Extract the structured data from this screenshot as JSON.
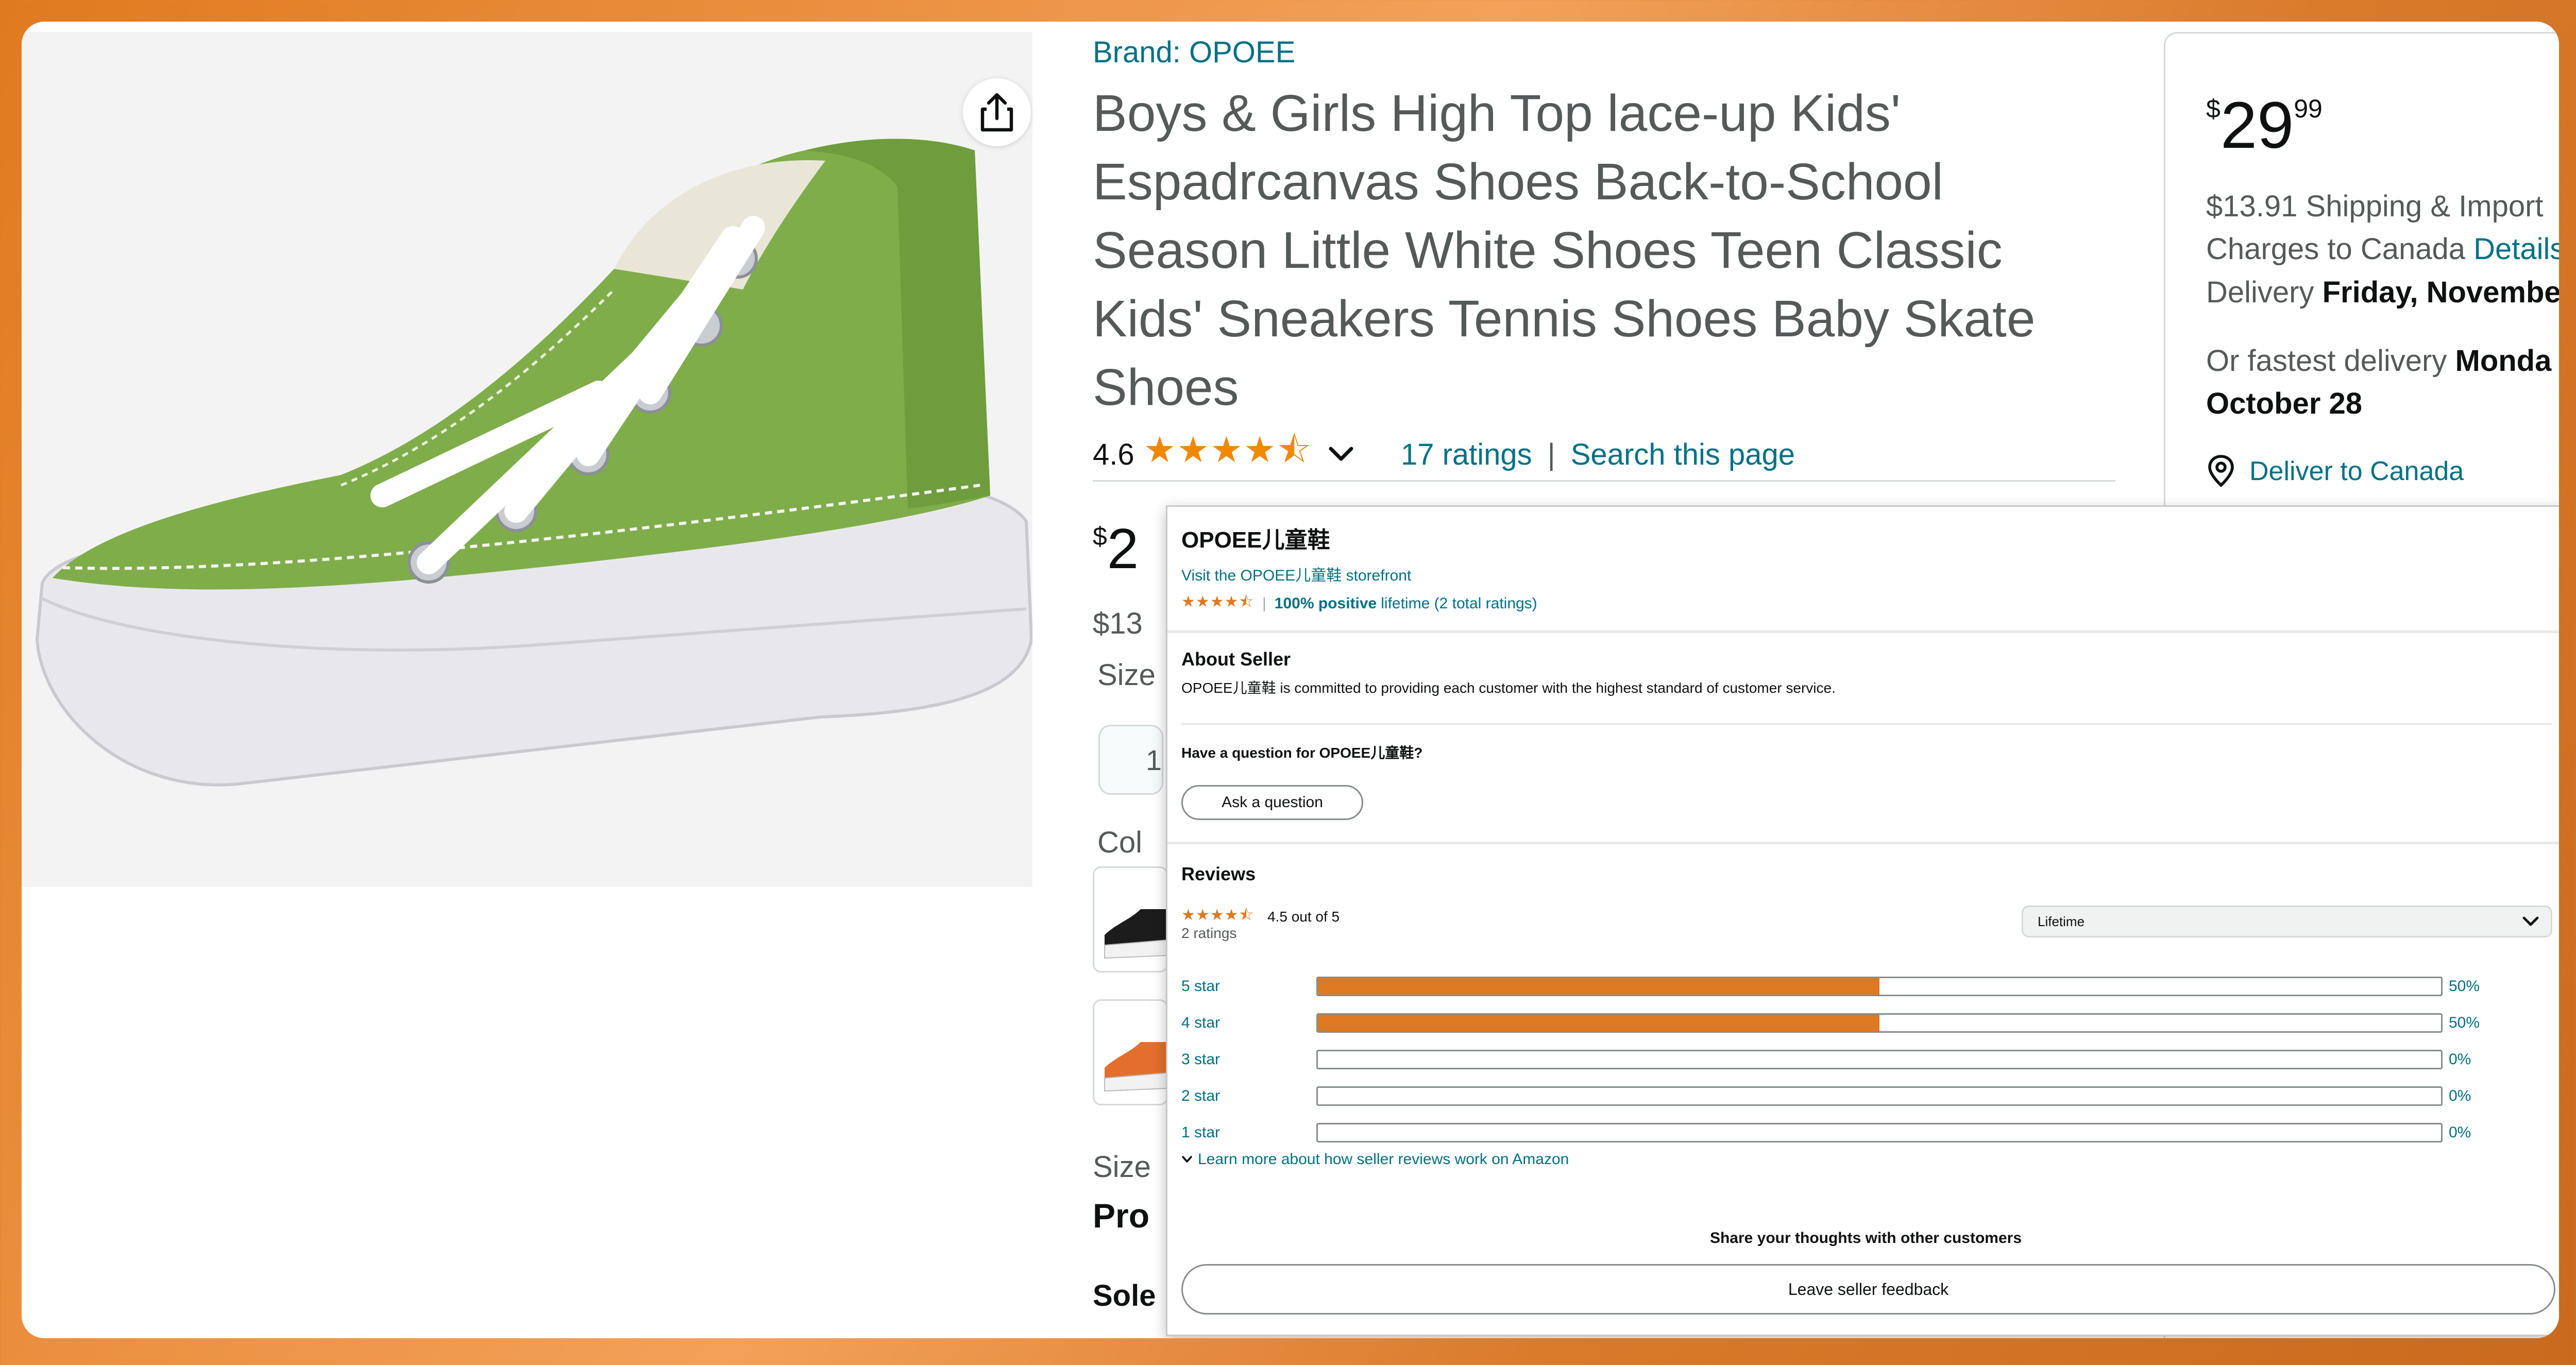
{
  "product": {
    "brand": "Brand: OPOEE",
    "title": "Boys & Girls High Top lace-up Kids' Espadrcanvas Shoes Back-to-School Season Little White Shoes Teen Classic Kids' Sneakers Tennis Shoes Baby Skate Shoes",
    "rating_value": "4.6",
    "rating_stars": "★★★★⯪",
    "ratings_link": "17 ratings",
    "separator": "|",
    "search_link": "Search this page",
    "price_fragment": "2",
    "price_fragment_sup": "$",
    "shipping_fragment": "$13",
    "size_label_fragment": "Size",
    "size_box_fragment": "1",
    "color_label_fragment": "Col",
    "size_link_fragment": "Size",
    "pro_fragment": "Pro",
    "sole_fragment": "Sole"
  },
  "buybox": {
    "price_currency": "$",
    "price_whole": "29",
    "price_fraction": "99",
    "shipping_line1": "$13.91 Shipping & Import",
    "shipping_line2": "Charges to Canada",
    "details_link": "Details",
    "delivery_prefix": "Delivery",
    "delivery_date": "Friday, November",
    "fastest_prefix": "Or fastest delivery",
    "fastest_day": "Monda",
    "fastest_date": "October 28",
    "deliver_to": "Deliver to Canada",
    "edge_frags": [
      "m",
      "ti",
      "e"
    ]
  },
  "seller_popup": {
    "seller_name": "OPOEE儿童鞋",
    "storefront_link": "Visit the OPOEE儿童鞋 storefront",
    "seller_stars": "★★★★⯪",
    "positive": "100% positive",
    "lifetime_note": "lifetime (2 total ratings)",
    "about_title": "About Seller",
    "about_text": "OPOEE儿童鞋 is committed to providing each customer with the highest standard of customer service.",
    "question_title": "Have a question for OPOEE儿童鞋?",
    "ask_button": "Ask a question",
    "reviews_title": "Reviews",
    "reviews_stars": "★★★★⯪",
    "reviews_score": "4.5 out of  5",
    "reviews_count": "2 ratings",
    "period_select": "Lifetime",
    "histogram": [
      {
        "label": "5 star",
        "pct_text": "50%",
        "pct": 50
      },
      {
        "label": "4 star",
        "pct_text": "50%",
        "pct": 50
      },
      {
        "label": "3 star",
        "pct_text": "0%",
        "pct": 0
      },
      {
        "label": "2 star",
        "pct_text": "0%",
        "pct": 0
      },
      {
        "label": "1 star",
        "pct_text": "0%",
        "pct": 0
      }
    ],
    "learn_more": "Learn more about how seller reviews work on Amazon",
    "share_thoughts": "Share your thoughts with other customers",
    "feedback_button": "Leave seller feedback"
  },
  "colors": {
    "link": "#007185",
    "star": "#de7921",
    "bar_fill": "#de7921",
    "shoe_green": "#7fad4a",
    "background_orange": "#e07a1f"
  }
}
